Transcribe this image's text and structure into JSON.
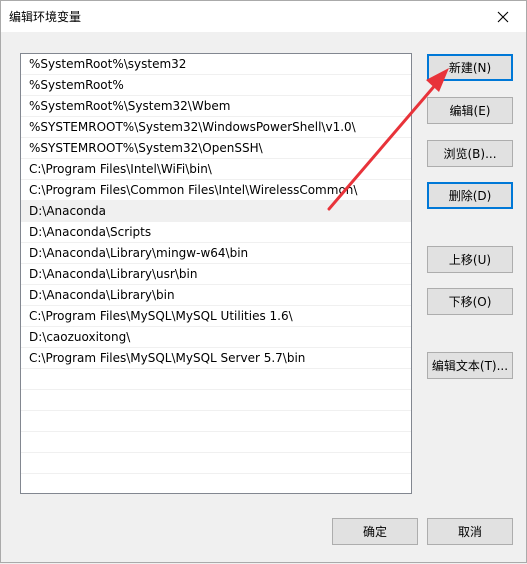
{
  "window": {
    "title": "编辑环境变量"
  },
  "list": {
    "selected_index": 7,
    "items": [
      "%SystemRoot%\\system32",
      "%SystemRoot%",
      "%SystemRoot%\\System32\\Wbem",
      "%SYSTEMROOT%\\System32\\WindowsPowerShell\\v1.0\\",
      "%SYSTEMROOT%\\System32\\OpenSSH\\",
      "C:\\Program Files\\Intel\\WiFi\\bin\\",
      "C:\\Program Files\\Common Files\\Intel\\WirelessCommon\\",
      "D:\\Anaconda",
      "D:\\Anaconda\\Scripts",
      "D:\\Anaconda\\Library\\mingw-w64\\bin",
      "D:\\Anaconda\\Library\\usr\\bin",
      "D:\\Anaconda\\Library\\bin",
      "C:\\Program Files\\MySQL\\MySQL Utilities 1.6\\",
      "D:\\caozuoxitong\\",
      "C:\\Program Files\\MySQL\\MySQL Server 5.7\\bin",
      "",
      "",
      "",
      "",
      "",
      ""
    ]
  },
  "buttons": {
    "new": "新建(N)",
    "edit": "编辑(E)",
    "browse": "浏览(B)...",
    "delete": "删除(D)",
    "move_up": "上移(U)",
    "move_down": "下移(O)",
    "edit_text": "编辑文本(T)...",
    "ok": "确定",
    "cancel": "取消"
  },
  "annotation": {
    "arrow_color": "#e8333a"
  }
}
